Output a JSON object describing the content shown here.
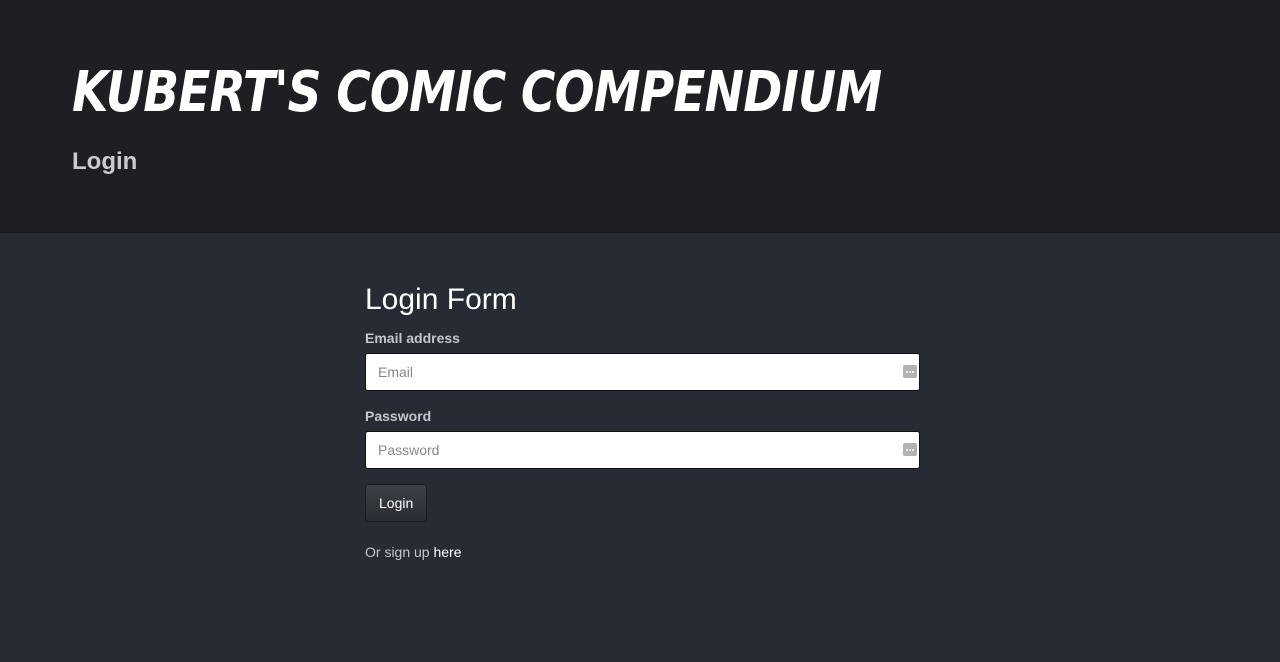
{
  "header": {
    "title": "Kubert's Comic Compendium",
    "subtitle": "Login"
  },
  "form": {
    "title": "Login Form",
    "email_label": "Email address",
    "email_placeholder": "Email",
    "password_label": "Password",
    "password_placeholder": "Password",
    "login_label": "Login",
    "signup_prefix": "Or sign up",
    "signup_link": "here"
  },
  "icons": {
    "field_key_icon": "password-manager-key-icon"
  },
  "colors": {
    "header_bg": "#1d1f23",
    "body_bg": "#272b33",
    "title_text": "#ffffff",
    "muted_text": "#c4c6c9"
  }
}
